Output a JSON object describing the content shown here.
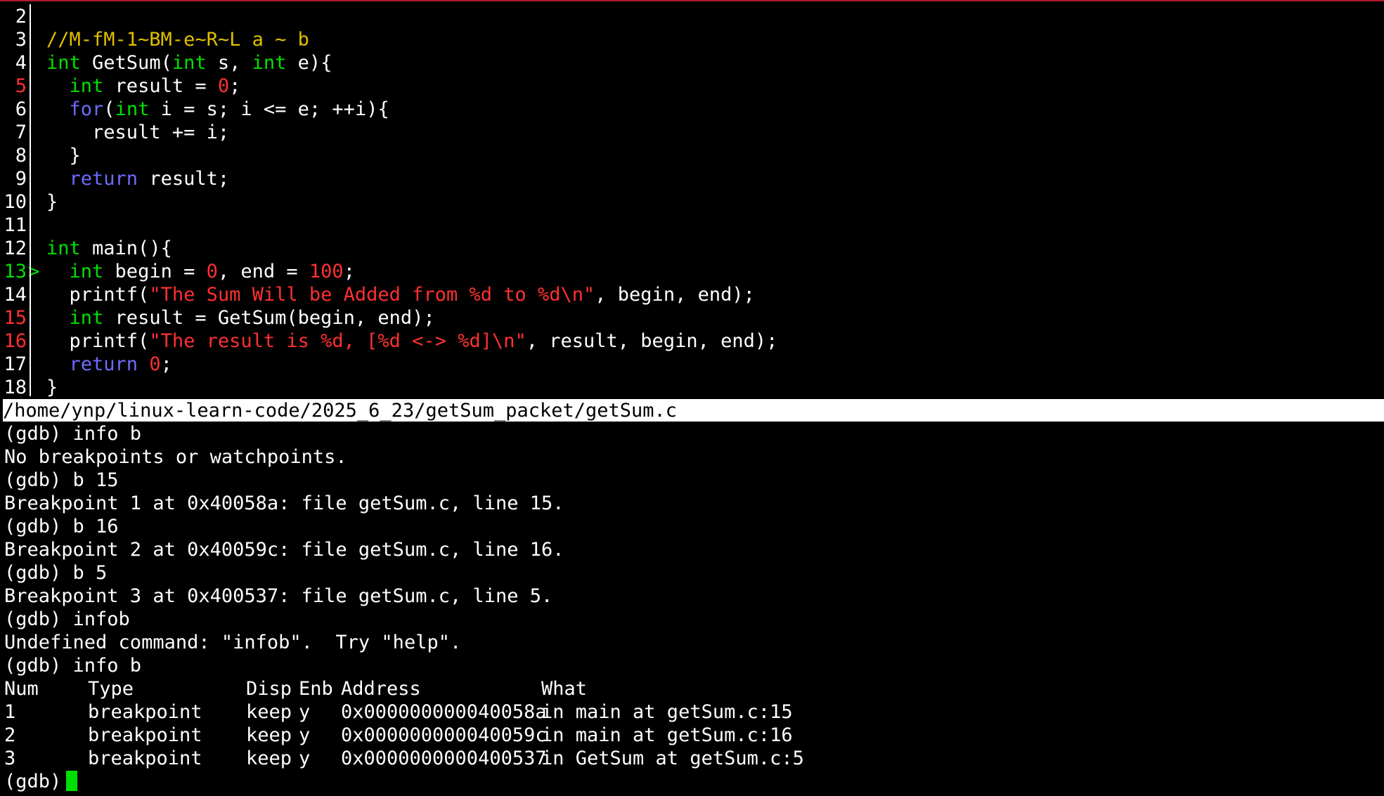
{
  "colors": {
    "keyword": "#00e000",
    "control": "#6c6cff",
    "string": "#ff3030",
    "number": "#ff3030",
    "comment": "#e0c000",
    "plain": "#ffffff",
    "arrow": "#00e000",
    "current_line_number": "#ff3030",
    "cursor": "#00e000"
  },
  "source": {
    "lines": [
      {
        "num": "2",
        "marker": "",
        "tokens": []
      },
      {
        "num": "3",
        "marker": "",
        "tokens": [
          {
            "t": "//M-fM-1~BM-e~R~L a ~ b",
            "c": "comment"
          }
        ]
      },
      {
        "num": "4",
        "marker": "",
        "tokens": [
          {
            "t": "int",
            "c": "keyword"
          },
          {
            "t": " GetSum(",
            "c": "plain"
          },
          {
            "t": "int",
            "c": "keyword"
          },
          {
            "t": " s, ",
            "c": "plain"
          },
          {
            "t": "int",
            "c": "keyword"
          },
          {
            "t": " e){",
            "c": "plain"
          }
        ]
      },
      {
        "num": "5",
        "marker": "",
        "num_color": "current_line_number",
        "tokens": [
          {
            "t": "  ",
            "c": "plain"
          },
          {
            "t": "int",
            "c": "keyword"
          },
          {
            "t": " result = ",
            "c": "plain"
          },
          {
            "t": "0",
            "c": "number"
          },
          {
            "t": ";",
            "c": "plain"
          }
        ]
      },
      {
        "num": "6",
        "marker": "",
        "tokens": [
          {
            "t": "  ",
            "c": "plain"
          },
          {
            "t": "for",
            "c": "control"
          },
          {
            "t": "(",
            "c": "plain"
          },
          {
            "t": "int",
            "c": "keyword"
          },
          {
            "t": " i = s; i <= e; ++i){",
            "c": "plain"
          }
        ]
      },
      {
        "num": "7",
        "marker": "",
        "tokens": [
          {
            "t": "    result += i;",
            "c": "plain"
          }
        ]
      },
      {
        "num": "8",
        "marker": "",
        "tokens": [
          {
            "t": "  }",
            "c": "plain"
          }
        ]
      },
      {
        "num": "9",
        "marker": "",
        "tokens": [
          {
            "t": "  ",
            "c": "plain"
          },
          {
            "t": "return",
            "c": "control"
          },
          {
            "t": " result;",
            "c": "plain"
          }
        ]
      },
      {
        "num": "10",
        "marker": "",
        "tokens": [
          {
            "t": "}",
            "c": "plain"
          }
        ]
      },
      {
        "num": "11",
        "marker": "",
        "tokens": []
      },
      {
        "num": "12",
        "marker": "",
        "tokens": [
          {
            "t": "int",
            "c": "keyword"
          },
          {
            "t": " main(){",
            "c": "plain"
          }
        ]
      },
      {
        "num": "13",
        "marker": ">",
        "num_color": "arrow",
        "tokens": [
          {
            "t": "  ",
            "c": "plain"
          },
          {
            "t": "int",
            "c": "keyword"
          },
          {
            "t": " begin = ",
            "c": "plain"
          },
          {
            "t": "0",
            "c": "number"
          },
          {
            "t": ", end = ",
            "c": "plain"
          },
          {
            "t": "100",
            "c": "number"
          },
          {
            "t": ";",
            "c": "plain"
          }
        ]
      },
      {
        "num": "14",
        "marker": "",
        "tokens": [
          {
            "t": "  printf(",
            "c": "plain"
          },
          {
            "t": "\"The Sum Will be Added from %d to %d\\n\"",
            "c": "string"
          },
          {
            "t": ", begin, end);",
            "c": "plain"
          }
        ]
      },
      {
        "num": "15",
        "marker": "",
        "num_color": "current_line_number",
        "tokens": [
          {
            "t": "  ",
            "c": "plain"
          },
          {
            "t": "int",
            "c": "keyword"
          },
          {
            "t": " result = GetSum(begin, end);",
            "c": "plain"
          }
        ]
      },
      {
        "num": "16",
        "marker": "",
        "num_color": "current_line_number",
        "tokens": [
          {
            "t": "  printf(",
            "c": "plain"
          },
          {
            "t": "\"The result is %d, [%d <-> %d]\\n\"",
            "c": "string"
          },
          {
            "t": ", result, begin, end);",
            "c": "plain"
          }
        ]
      },
      {
        "num": "17",
        "marker": "",
        "tokens": [
          {
            "t": "  ",
            "c": "plain"
          },
          {
            "t": "return",
            "c": "control"
          },
          {
            "t": " ",
            "c": "plain"
          },
          {
            "t": "0",
            "c": "number"
          },
          {
            "t": ";",
            "c": "plain"
          }
        ]
      },
      {
        "num": "18",
        "marker": "",
        "tokens": [
          {
            "t": "}",
            "c": "plain"
          }
        ]
      }
    ]
  },
  "status_bar": {
    "path": "/home/ynp/linux-learn-code/2025_6_23/getSum_packet/getSum.c"
  },
  "console": {
    "lines": [
      "(gdb) info b",
      "No breakpoints or watchpoints.",
      "(gdb) b 15",
      "Breakpoint 1 at 0x40058a: file getSum.c, line 15.",
      "(gdb) b 16",
      "Breakpoint 2 at 0x40059c: file getSum.c, line 16.",
      "(gdb) b 5",
      "Breakpoint 3 at 0x400537: file getSum.c, line 5.",
      "(gdb) infob",
      "Undefined command: \"infob\".  Try \"help\".",
      "(gdb) info b"
    ],
    "table": {
      "headers": [
        "Num",
        "Type",
        "Disp",
        "Enb",
        "Address",
        "What"
      ],
      "rows": [
        [
          "1",
          "breakpoint",
          "keep",
          "y",
          "0x000000000040058a",
          "in main at getSum.c:15"
        ],
        [
          "2",
          "breakpoint",
          "keep",
          "y",
          "0x000000000040059c",
          "in main at getSum.c:16"
        ],
        [
          "3",
          "breakpoint",
          "keep",
          "y",
          "0x0000000000400537",
          "in GetSum at getSum.c:5"
        ]
      ]
    },
    "prompt": "(gdb) "
  }
}
